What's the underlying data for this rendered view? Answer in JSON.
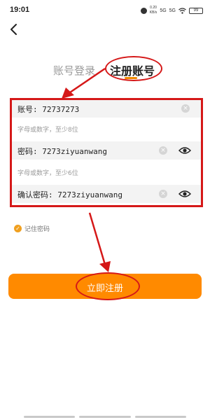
{
  "status_bar": {
    "time": "19:01",
    "speed": "0.20\nKB/s",
    "signal_1": "5G",
    "signal_2": "5G",
    "battery": "99"
  },
  "tabs": {
    "login": "账号登录",
    "register": "注册账号"
  },
  "form": {
    "account": {
      "label": "账号: 72737273",
      "hint": "字母或数字，至少8位"
    },
    "password": {
      "label": "密码: 7273ziyuanwang",
      "hint": "字母或数字，至少6位"
    },
    "confirm": {
      "label": "确认密码: 7273ziyuanwang"
    }
  },
  "remember_label": "记住密码",
  "register_button": "立即注册",
  "colors": {
    "accent": "#ff8a00",
    "annotation": "#d51818"
  }
}
